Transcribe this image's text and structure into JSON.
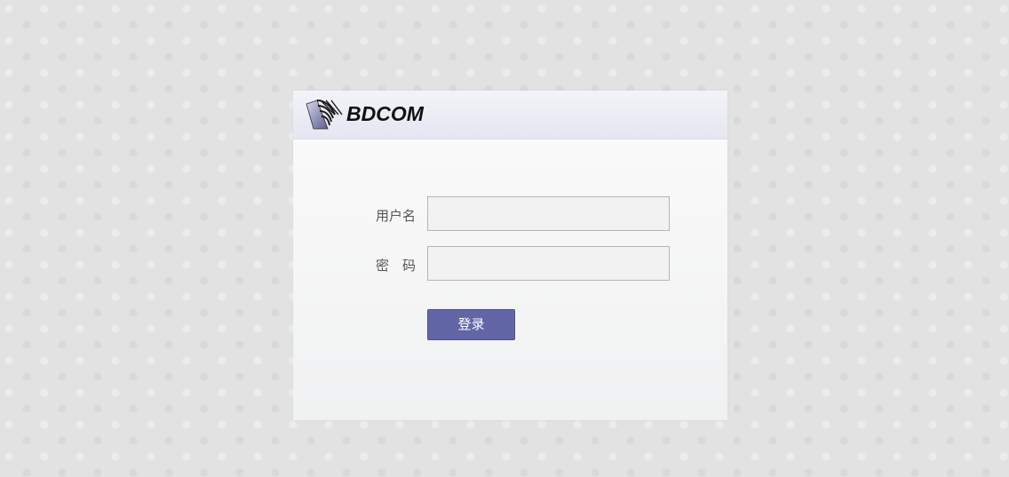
{
  "logo": {
    "brand_text": "BDCOM",
    "icon": "bdcom-stripes-logo-icon"
  },
  "login_form": {
    "username_label": "用户名",
    "username_value": "",
    "username_placeholder": "",
    "password_label": "密　码",
    "password_value": "",
    "password_placeholder": "",
    "submit_label": "登录"
  },
  "colors": {
    "page_background": "#e2e2e2",
    "header_background": "#e4e6f1",
    "button_background": "#6265a6",
    "input_background": "#f2f2f2",
    "label_text": "#555555"
  }
}
